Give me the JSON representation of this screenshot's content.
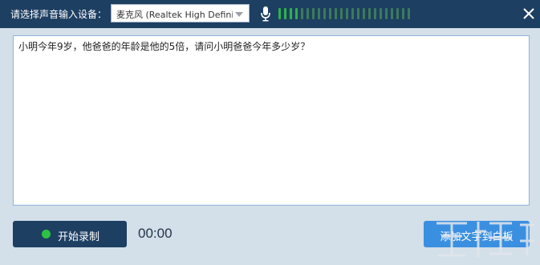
{
  "header": {
    "device_label": "请选择声音输入设备：",
    "device_selected": "麦克风 (Realtek High Definition Audio)",
    "input_level": {
      "active_bars": 4,
      "total_bars": 24
    },
    "colors": {
      "bar_active": "#2db34a",
      "bar_inactive": "#3d7a5a",
      "titlebar": "#1d3f62"
    },
    "icons": {
      "mic": "microphone-icon",
      "close": "close-icon"
    }
  },
  "editor": {
    "text": "小明今年9岁，他爸爸的年龄是他的5倍，请问小明爸爸今年多少岁？"
  },
  "footer": {
    "record_label": "开始录制",
    "timer": "00:00",
    "add_label": "添加文字到白板",
    "colors": {
      "record_indicator": "#2ec242",
      "add_button": "#3b8fe0"
    }
  }
}
